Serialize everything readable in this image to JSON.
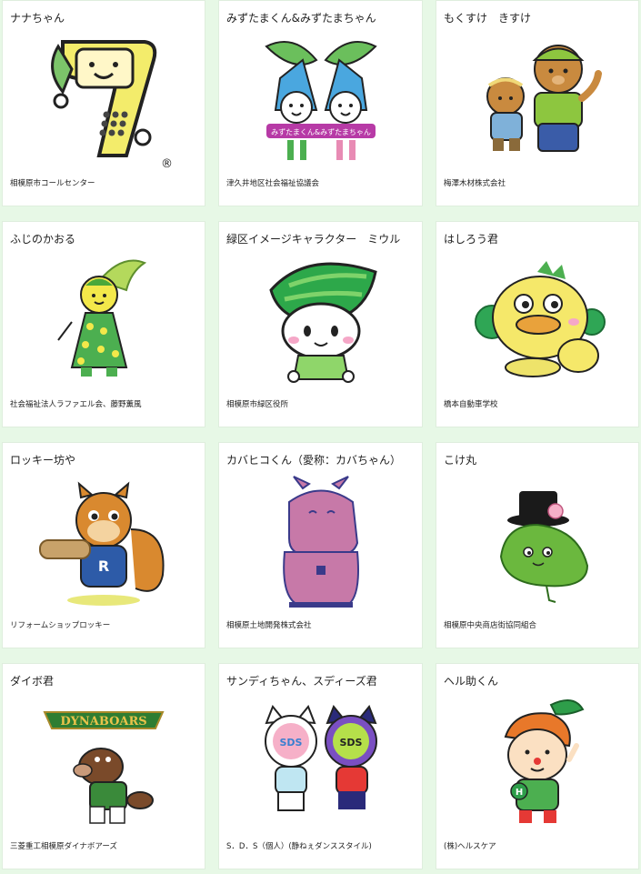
{
  "cards": [
    {
      "title": "ナナちゃん",
      "caption": "相模原市コールセンター",
      "icon": "nana-chan-mascot-icon",
      "color": "#f3ec6b",
      "mark": "®"
    },
    {
      "title": "みずたまくん&みずたまちゃん",
      "caption": "津久井地区社会福祉協議会",
      "icon": "mizutama-mascot-icon",
      "color": "#5fb85a",
      "mark": "みずたまくん&みずたまちゃん"
    },
    {
      "title": "もくすけ　きすけ",
      "caption": "梅澤木材株式会社",
      "icon": "mokusuke-kisuke-bears-icon",
      "color": "#c98a3f"
    },
    {
      "title": "ふじのかおる",
      "caption": "社会福祉法人ラファエル会、藤野薫風",
      "icon": "fujino-kaoru-mascot-icon",
      "color": "#58b945"
    },
    {
      "title": "緑区イメージキャラクター　ミウル",
      "caption": "相模原市緑区役所",
      "icon": "miuru-leaf-mascot-icon",
      "color": "#2da84a"
    },
    {
      "title": "はしろう君",
      "caption": "橋本自動車学校",
      "icon": "hashirou-mascot-icon",
      "color": "#f5e86a"
    },
    {
      "title": "ロッキー坊や",
      "caption": "リフォームショップロッキー",
      "icon": "rocky-squirrel-mascot-icon",
      "color": "#d9892f",
      "mark": "R"
    },
    {
      "title": "カバヒコくん（愛称：カバちゃん）",
      "caption": "相模原土地開発株式会社",
      "icon": "kabahiko-hippo-mascot-icon",
      "color": "#c779a8"
    },
    {
      "title": "こけ丸",
      "caption": "相模原中央商店街協同組合",
      "icon": "kokemaru-moss-mascot-icon",
      "color": "#6bb83e"
    },
    {
      "title": "ダイボ君",
      "caption": "三菱重工相模原ダイナボアーズ",
      "icon": "daibo-boar-mascot-icon",
      "color": "#7a4a2a",
      "mark": "DYNABOARS"
    },
    {
      "title": "サンディちゃん、スディーズ君",
      "caption": "S．D．S（個人）(静ねぇダンススタイル)",
      "icon": "sds-cats-mascot-icon",
      "color": "#7a4fc2",
      "mark": "SDS"
    },
    {
      "title": "ヘル助くん",
      "caption": "(株)ヘルスケア",
      "icon": "herusuke-mascot-icon",
      "color": "#e8782a",
      "mark": "H"
    }
  ]
}
